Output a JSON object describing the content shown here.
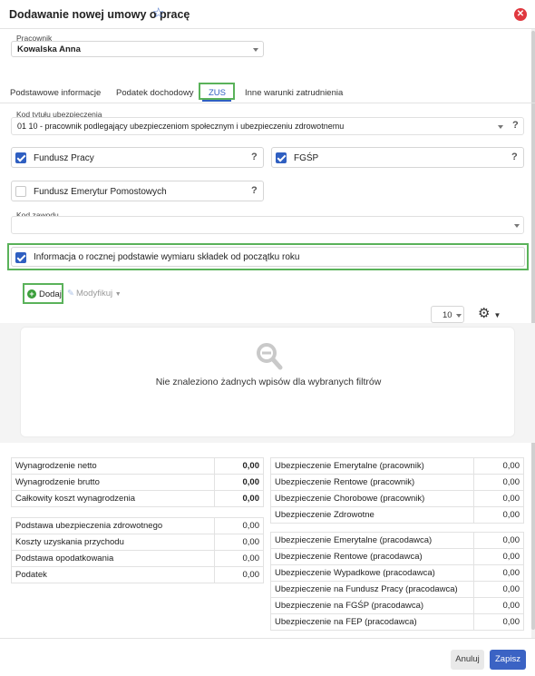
{
  "dialog": {
    "title": "Dodawanie nowej umowy o pracę",
    "star_icon": "star-icon",
    "close_icon": "close-icon"
  },
  "employee": {
    "label": "Pracownik",
    "value": "Kowalska Anna"
  },
  "tabs": [
    {
      "label": "Podstawowe informacje"
    },
    {
      "label": "Podatek dochodowy"
    },
    {
      "label": "ZUS"
    },
    {
      "label": "Inne warunki zatrudnienia"
    }
  ],
  "insurance_code": {
    "label": "Kod tytułu ubezpieczenia",
    "value": "01 10 - pracownik podlegający ubezpieczeniom społecznym i ubezpieczeniu zdrowotnemu",
    "help": "?"
  },
  "checkboxes": {
    "fundusz_pracy": {
      "label": "Fundusz Pracy",
      "checked": true,
      "help": "?"
    },
    "fgsp": {
      "label": "FGŚP",
      "checked": true,
      "help": "?"
    },
    "femp": {
      "label": "Fundusz Emerytur Pomostowych",
      "checked": false,
      "help": "?"
    },
    "annual_info": {
      "label": "Informacja o rocznej podstawie wymiaru składek od początku roku",
      "checked": true
    }
  },
  "profession_code": {
    "label": "Kod zawodu",
    "value": ""
  },
  "toolbar": {
    "add_label": "Dodaj",
    "modify_label": "Modyfikuj",
    "page_size": "10"
  },
  "empty_state": {
    "message": "Nie znaleziono żadnych wpisów dla wybranych filtrów"
  },
  "summary_left_top": [
    {
      "label": "Wynagrodzenie netto",
      "value": "0,00"
    },
    {
      "label": "Wynagrodzenie brutto",
      "value": "0,00"
    },
    {
      "label": "Całkowity koszt wynagrodzenia",
      "value": "0,00"
    }
  ],
  "summary_left_bottom": [
    {
      "label": "Podstawa ubezpieczenia zdrowotnego",
      "value": "0,00"
    },
    {
      "label": "Koszty uzyskania przychodu",
      "value": "0,00"
    },
    {
      "label": "Podstawa opodatkowania",
      "value": "0,00"
    },
    {
      "label": "Podatek",
      "value": "0,00"
    }
  ],
  "summary_right_top": [
    {
      "label": "Ubezpieczenie Emerytalne (pracownik)",
      "value": "0,00"
    },
    {
      "label": "Ubezpieczenie Rentowe (pracownik)",
      "value": "0,00"
    },
    {
      "label": "Ubezpieczenie Chorobowe (pracownik)",
      "value": "0,00"
    },
    {
      "label": "Ubezpieczenie Zdrowotne",
      "value": "0,00"
    }
  ],
  "summary_right_bottom": [
    {
      "label": "Ubezpieczenie Emerytalne (pracodawca)",
      "value": "0,00"
    },
    {
      "label": "Ubezpieczenie Rentowe (pracodawca)",
      "value": "0,00"
    },
    {
      "label": "Ubezpieczenie Wypadkowe (pracodawca)",
      "value": "0,00"
    },
    {
      "label": "Ubezpieczenie na Fundusz Pracy (pracodawca)",
      "value": "0,00"
    },
    {
      "label": "Ubezpieczenie na FGŚP (pracodawca)",
      "value": "0,00"
    },
    {
      "label": "Ubezpieczenie na FEP (pracodawca)",
      "value": "0,00"
    }
  ],
  "footer": {
    "cancel_label": "Anuluj",
    "save_label": "Zapisz"
  },
  "colors": {
    "accent": "#2f5fc1",
    "highlight": "#5ab25a",
    "save_button": "#3b63c4",
    "close_button": "#e0383f"
  }
}
